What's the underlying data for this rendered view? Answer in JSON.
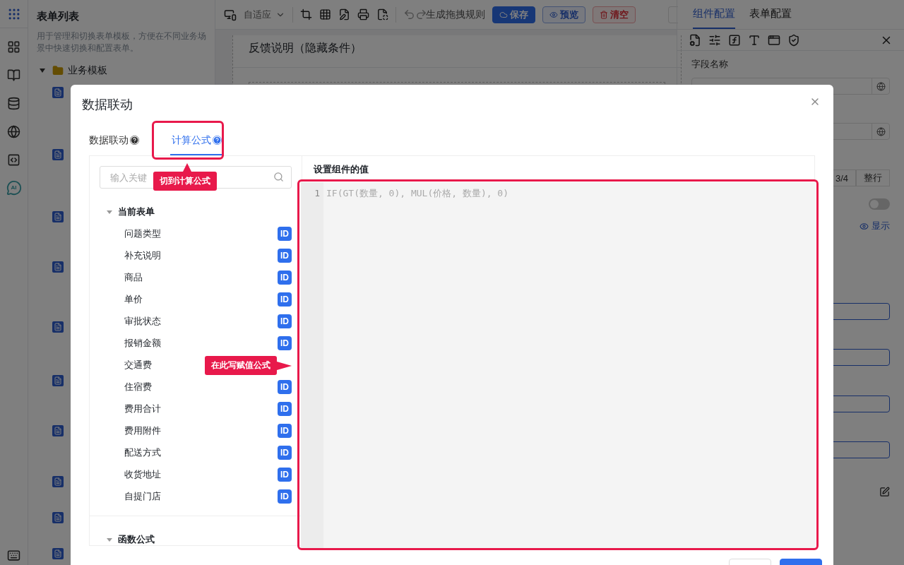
{
  "rail": {
    "ai_label": "AI"
  },
  "form_list": {
    "title": "表单列表",
    "description": "用于管理和切换表单模板，方便在不同业务场景中快速切换和配置表单。",
    "folder": {
      "label": "业务模板",
      "expanded": true
    }
  },
  "toolbar": {
    "layout_select": "自适应",
    "rule_label": "生成拖拽规则",
    "buttons": [
      {
        "label": "保存",
        "kind": "primary"
      },
      {
        "label": "预览",
        "kind": "outline"
      },
      {
        "label": "清空",
        "kind": "danger"
      }
    ]
  },
  "canvas": {
    "section_title": "反馈说明（隐藏条件）"
  },
  "config_panel": {
    "tabs": [
      {
        "label": "组件配置",
        "selected": true
      },
      {
        "label": "表单配置",
        "selected": false
      }
    ],
    "field_label": "字段名称",
    "width_options": [
      {
        "label": "3/4",
        "selected": false
      },
      {
        "label": "整行",
        "selected": false
      }
    ],
    "toggle_on": false,
    "visibility": "显示"
  },
  "dialog": {
    "title": "数据联动",
    "tabs": [
      {
        "label": "数据联动",
        "selected": false
      },
      {
        "label": "计算公式",
        "selected": true
      }
    ],
    "search": {
      "placeholder": "输入关键"
    },
    "field_groups": [
      {
        "label": "当前表单",
        "expanded": true,
        "children": [
          {
            "label": "问题类型",
            "badge": "ID"
          },
          {
            "label": "补充说明",
            "badge": "ID"
          },
          {
            "label": "商品",
            "badge": "ID"
          },
          {
            "label": "单价",
            "badge": "ID"
          },
          {
            "label": "审批状态",
            "badge": "ID"
          },
          {
            "label": "报销金额",
            "badge": "ID"
          },
          {
            "label": "交通费"
          },
          {
            "label": "住宿费",
            "badge": "ID"
          },
          {
            "label": "费用合计",
            "badge": "ID"
          },
          {
            "label": "费用附件",
            "badge": "ID"
          },
          {
            "label": "配送方式",
            "badge": "ID"
          },
          {
            "label": "收货地址",
            "badge": "ID"
          },
          {
            "label": "自提门店",
            "badge": "ID"
          }
        ]
      },
      {
        "label": "函数公式",
        "expanded": true
      }
    ],
    "editor": {
      "label": "设置组件的值",
      "lines": [
        {
          "number": "1",
          "code": "IF(GT(数量, 0), MUL(价格, 数量), 0)"
        }
      ]
    },
    "annotations": [
      {
        "kind": "tab",
        "text": "切到计算公式"
      },
      {
        "kind": "editor",
        "text": "在此写赋值公式"
      }
    ]
  }
}
